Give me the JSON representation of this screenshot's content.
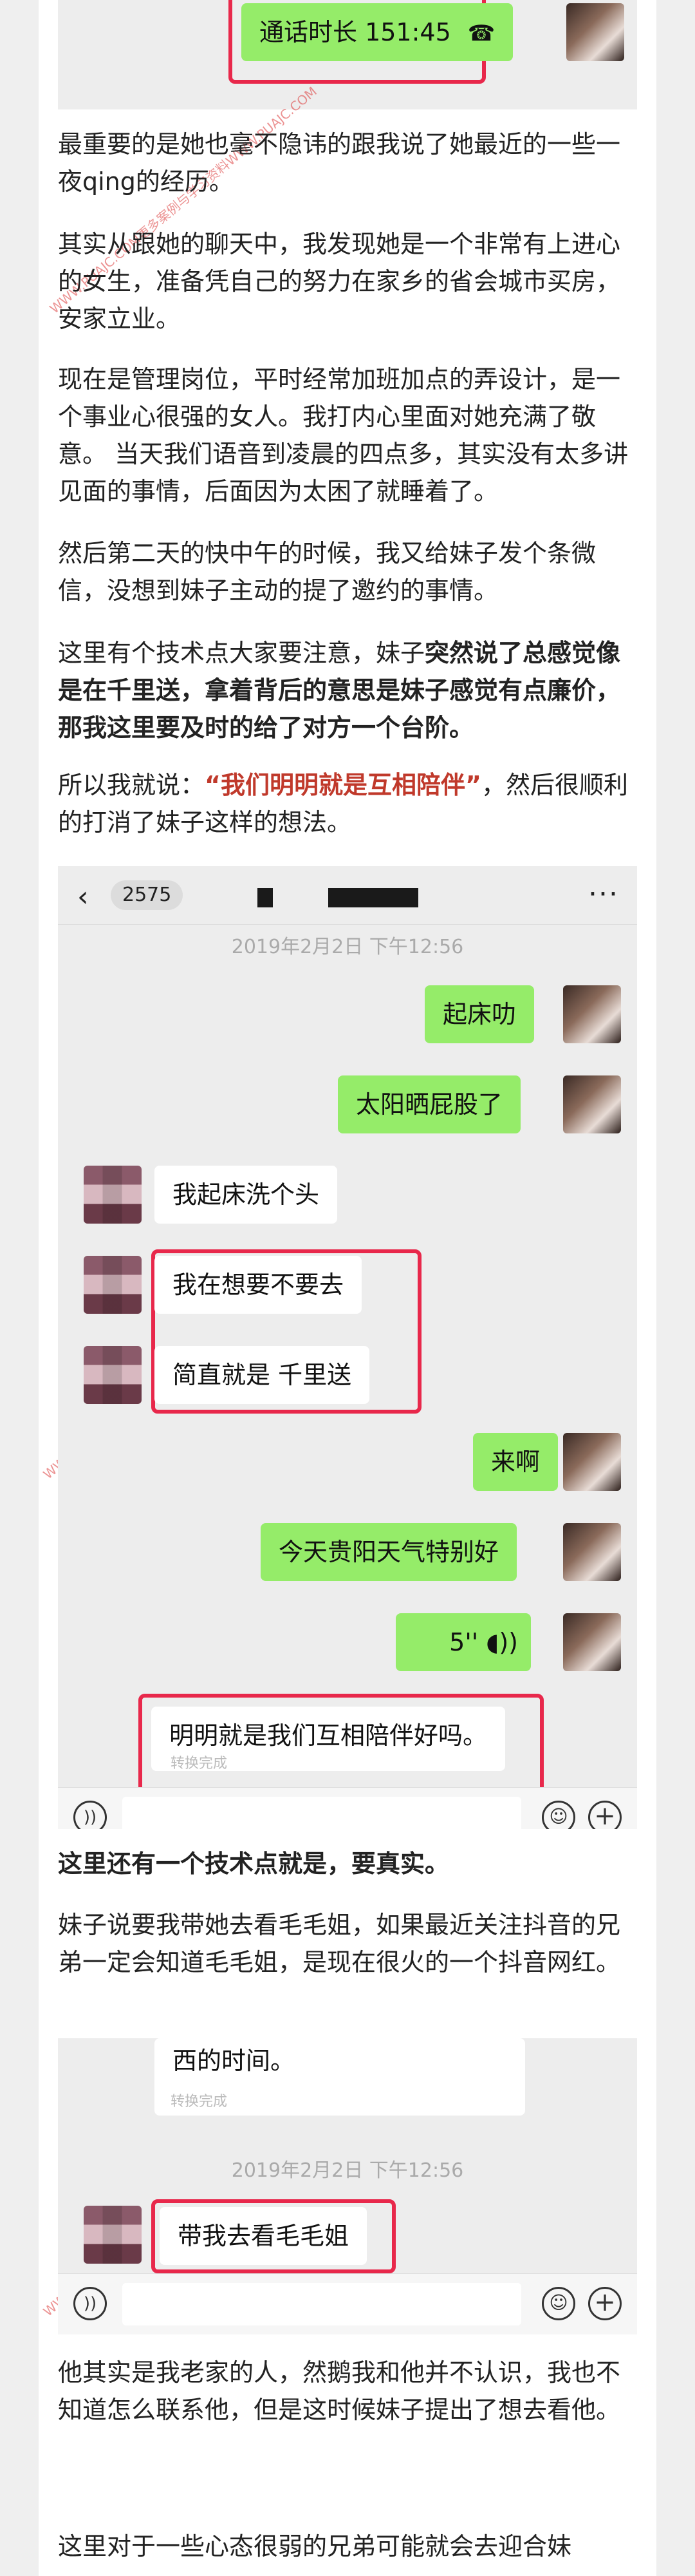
{
  "top_shot": {
    "call_label": "通话时长 151:45",
    "call_icon": "phone-hangup-icon"
  },
  "paragraphs": {
    "p1": "最重要的是她也毫不隐讳的跟我说了她最近的一些一夜qing的经历。",
    "p2": "其实从跟她的聊天中，我发现她是一个非常有上进心的女生，准备凭自己的努力在家乡的省会城市买房，安家立业。",
    "p3": "现在是管理岗位，平时经常加班加点的弄设计，是一个事业心很强的女人。我打内心里面对她充满了敬意。 当天我们语音到凌晨的四点多，其实没有太多讲见面的事情，后面因为太困了就睡着了。",
    "p4": "然后第二天的快中午的时候，我又给妹子发个条微信，没想到妹子主动的提了邀约的事情。",
    "p5_a": "这里有个技术点大家要注意，妹子",
    "p5_b": "突然说了总感觉像是在千里送，拿着背后的意思是妹子感觉有点廉价，那我这里要及时的给了对方一个台阶。",
    "p6_a": "所以我就说：",
    "p6_b": "“我们明明就是互相陪伴”",
    "p6_c": "，然后很顺利的打消了妹子这样的想法。",
    "p7": "这里还有一个技术点就是，要真实。",
    "p8": "妹子说要我带她去看毛毛姐，如果最近关注抖音的兄弟一定会知道毛毛姐，是现在很火的一个抖音网红。",
    "p9": "他其实是我老家的人，然鹅我和他并不认识，我也不知道怎么联系他，但是这时候妹子提出了想去看他。",
    "p10": "这里对于一些心态很弱的兄弟可能就会去迎合妹"
  },
  "chat1": {
    "back_label": "2575",
    "timestamp": "2019年2月2日 下午12:56",
    "messages": [
      {
        "side": "right",
        "text": "起床叻"
      },
      {
        "side": "right",
        "text": "太阳晒屁股了"
      },
      {
        "side": "left",
        "text": "我起床洗个头"
      },
      {
        "side": "left",
        "text": "我在想要不要去"
      },
      {
        "side": "left",
        "text": "简直就是 千里送"
      },
      {
        "side": "right",
        "text": "来啊"
      },
      {
        "side": "right",
        "text": "今天贵阳天气特别好"
      },
      {
        "side": "right",
        "text": "5''"
      },
      {
        "side": "left",
        "text": "明明就是我们互相陪伴好吗。"
      }
    ],
    "convert_done": "转换完成"
  },
  "chat2": {
    "prev_msg": "西的时间。",
    "convert_done": "转换完成",
    "timestamp": "2019年2月2日 下午12:56",
    "message": "带我去看毛毛姐"
  },
  "watermark": "WWW.PUAJC.COM更多案例与学习资料WWW.PUAJC.COM",
  "colors": {
    "green_bubble": "#95ec69",
    "highlight_box": "#e8284b",
    "emphasis_red": "#c0392b"
  },
  "icons": [
    "back-arrow-icon",
    "more-icon",
    "voice-icon",
    "emoji-icon",
    "plus-icon",
    "voice-wave-icon"
  ]
}
